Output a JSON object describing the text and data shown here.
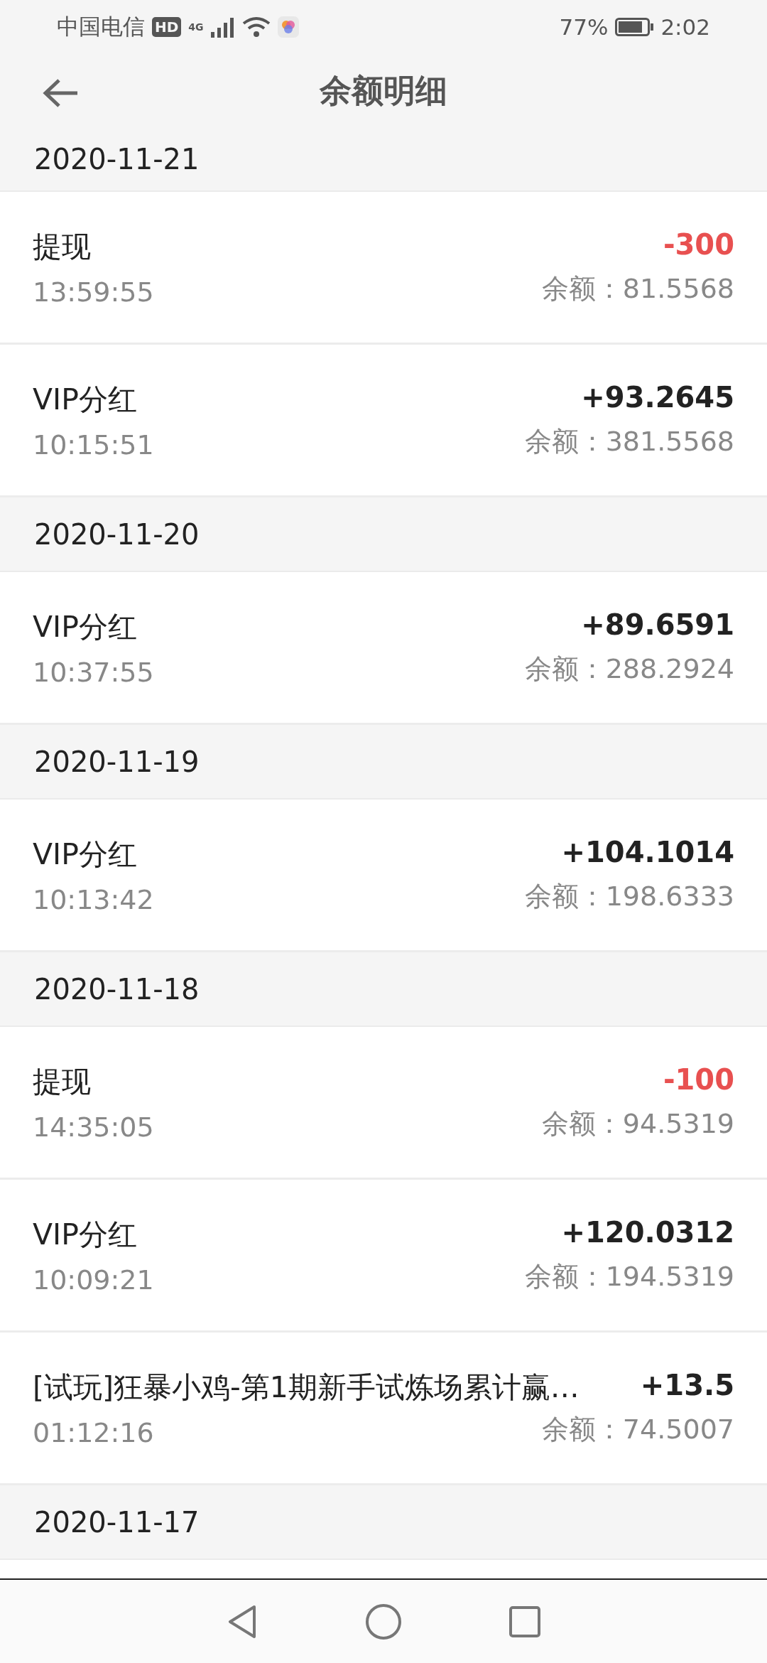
{
  "status_bar": {
    "carrier": "中国电信",
    "hd_badge": "HD",
    "network": "4G",
    "battery": "77%",
    "time": "2:02"
  },
  "header": {
    "title": "余额明细"
  },
  "groups": [
    {
      "date": "2020-11-21",
      "entries": [
        {
          "title": "提现",
          "time": "13:59:55",
          "amount": "-300",
          "balance": "余额：81.5568",
          "kind": "debit"
        },
        {
          "title": "VIP分红",
          "time": "10:15:51",
          "amount": "+93.2645",
          "balance": "余额：381.5568",
          "kind": "credit"
        }
      ]
    },
    {
      "date": "2020-11-20",
      "entries": [
        {
          "title": "VIP分红",
          "time": "10:37:55",
          "amount": "+89.6591",
          "balance": "余额：288.2924",
          "kind": "credit"
        }
      ]
    },
    {
      "date": "2020-11-19",
      "entries": [
        {
          "title": "VIP分红",
          "time": "10:13:42",
          "amount": "+104.1014",
          "balance": "余额：198.6333",
          "kind": "credit"
        }
      ]
    },
    {
      "date": "2020-11-18",
      "entries": [
        {
          "title": "提现",
          "time": "14:35:05",
          "amount": "-100",
          "balance": "余额：94.5319",
          "kind": "debit"
        },
        {
          "title": "VIP分红",
          "time": "10:09:21",
          "amount": "+120.0312",
          "balance": "余额：194.5319",
          "kind": "credit"
        },
        {
          "title": "[试玩]狂暴小鸡-第1期新手试炼场累计赢…",
          "time": "01:12:16",
          "amount": "+13.5",
          "balance": "余额：74.5007",
          "kind": "credit"
        }
      ]
    },
    {
      "date": "2020-11-17"
    }
  ]
}
